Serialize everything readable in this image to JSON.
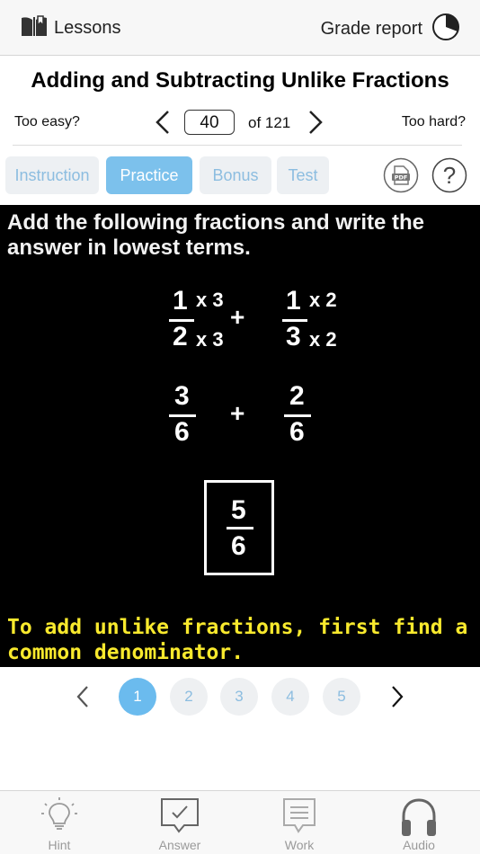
{
  "header": {
    "lessons_label": "Lessons",
    "grade_report_label": "Grade report"
  },
  "title": "Adding and Subtracting Unlike Fractions",
  "navigation": {
    "too_easy": "Too easy?",
    "too_hard": "Too hard?",
    "current": "40",
    "of_total": "of 121"
  },
  "tabs": [
    {
      "label": "Instruction",
      "active": false
    },
    {
      "label": "Practice",
      "active": true
    },
    {
      "label": "Bonus",
      "active": false
    },
    {
      "label": "Test",
      "active": false
    }
  ],
  "pdf_icon_text": "PDF",
  "help_icon_text": "?",
  "board": {
    "instruction": "Add the following fractions and write the answer in lowest terms.",
    "step1": {
      "a_num": "1",
      "a_num_mult": "x 3",
      "a_den": "2",
      "a_den_mult": "x 3",
      "operator": "+",
      "b_num": "1",
      "b_num_mult": "x 2",
      "b_den": "3",
      "b_den_mult": "x 2"
    },
    "step2": {
      "a_num": "3",
      "a_den": "6",
      "operator": "+",
      "b_num": "2",
      "b_den": "6"
    },
    "answer": {
      "num": "5",
      "den": "6"
    },
    "tip": "To add unlike fractions, first find a common denominator."
  },
  "pager": {
    "pages": [
      "1",
      "2",
      "3",
      "4",
      "5"
    ],
    "active_index": 0
  },
  "bottom_bar": {
    "hint": "Hint",
    "answer": "Answer",
    "work": "Work",
    "audio": "Audio"
  },
  "colors": {
    "accent": "#7cc1ec",
    "board_bg": "#000000",
    "tip_text": "#f8e92d",
    "inactive_tab_text": "#8cbde0"
  }
}
